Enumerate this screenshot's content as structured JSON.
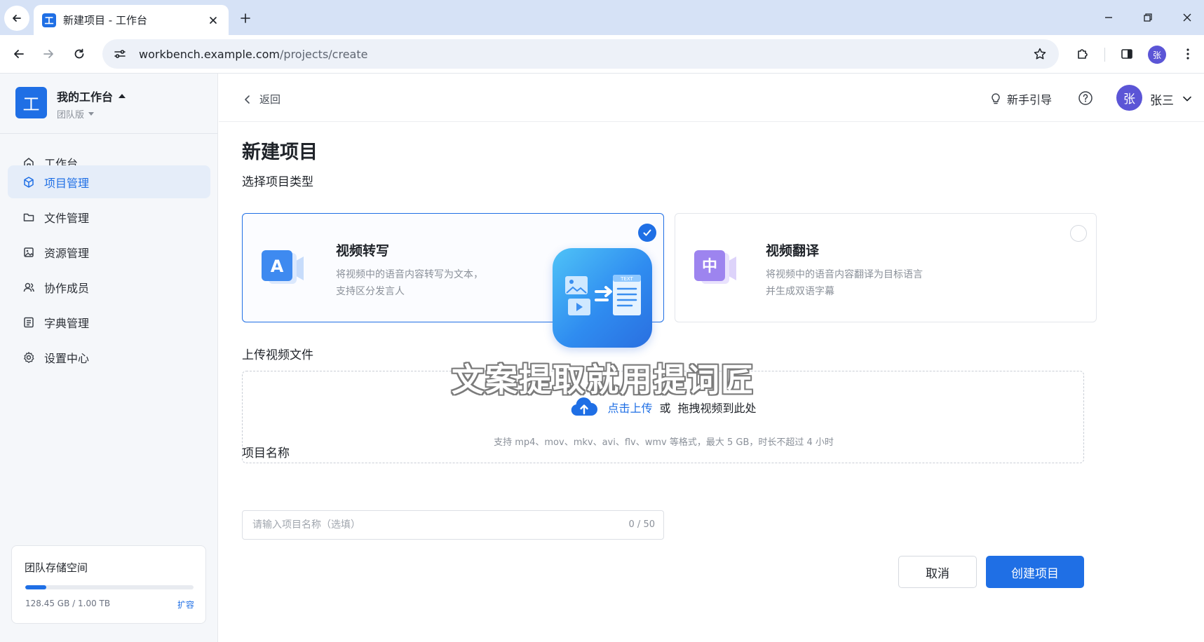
{
  "browser": {
    "tab_title": "新建项目 - 工作台",
    "tab_favicon": "工",
    "url_host": "workbench.example.com",
    "url_path": "/projects/create",
    "profile_initial": "张"
  },
  "sidebar": {
    "workspace_logo": "工",
    "workspace_name": "我的工作台",
    "workspace_plan": "团队版",
    "items": [
      {
        "label": "工作台",
        "icon": "home-icon",
        "active": false
      },
      {
        "label": "项目管理",
        "icon": "cube-icon",
        "active": true
      },
      {
        "label": "文件管理",
        "icon": "folder-icon",
        "active": false
      },
      {
        "label": "资源管理",
        "icon": "image-resource-icon",
        "active": false
      },
      {
        "label": "协作成员",
        "icon": "users-icon",
        "active": false
      },
      {
        "label": "字典管理",
        "icon": "dictionary-icon",
        "active": false
      },
      {
        "label": "设置中心",
        "icon": "gear-icon",
        "active": false
      }
    ],
    "storage": {
      "title": "团队存储空间",
      "used_text": "128.45 GB / 1.00 TB",
      "used_fraction": 0.1254,
      "expand_label": "扩容"
    }
  },
  "topbar": {
    "back_label": "返回",
    "guide_label": "新手引导",
    "user_initial": "张",
    "user_name": "张三"
  },
  "main": {
    "title": "新建项目",
    "type_section_label": "选择项目类型",
    "types": [
      {
        "title": "视频转写",
        "icon_letter": "A",
        "desc_line1": "将视频中的语音内容转写为文本，",
        "desc_line2": "支持区分发言人",
        "selected": true
      },
      {
        "title": "视频翻译",
        "icon_letter": "中",
        "desc_line1": "将视频中的语音内容翻译为目标语言",
        "desc_line2": "并生成双语字幕",
        "selected": false
      }
    ],
    "upload_section_label": "上传视频文件",
    "upload": {
      "click_label": "点击上传",
      "or_label": "或",
      "drag_label": "拖拽视频到此处",
      "hint": "支持 mp4、mov、mkv、avi、flv、wmv 等格式，最大 5 GB，时长不超过 4 小时"
    },
    "name_section_label": "项目名称",
    "name_input": {
      "value": "",
      "placeholder": "请输入项目名称（选填）",
      "counter": "0 / 50"
    },
    "cancel_label": "取消",
    "create_label": "创建项目"
  },
  "watermark": {
    "badge_text": "TEXT",
    "text": "文案提取就用提词匠"
  },
  "colors": {
    "accent": "#1f6fe5",
    "avatar": "#5b55d6",
    "tabbar": "#d6e2f6",
    "sidebar_bg": "#f5f7fa"
  }
}
